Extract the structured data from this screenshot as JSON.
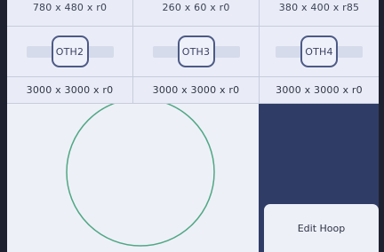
{
  "sizes_top": [
    "780 x 480 x r0",
    "260 x 60 x r0",
    "380 x 400 x r85"
  ],
  "hoops": [
    {
      "label": "OTH2"
    },
    {
      "label": "OTH3"
    },
    {
      "label": "OTH4"
    }
  ],
  "sizes_bottom": [
    "3000 x 3000 x r0",
    "3000 x 3000 x r0",
    "3000 x 3000 x r0"
  ],
  "edit_hoop_label": "Edit Hoop",
  "colors": {
    "hoop_circle": "#4fa883",
    "panel_dark": "#2f3d66",
    "pill_border": "#4d5a86"
  }
}
